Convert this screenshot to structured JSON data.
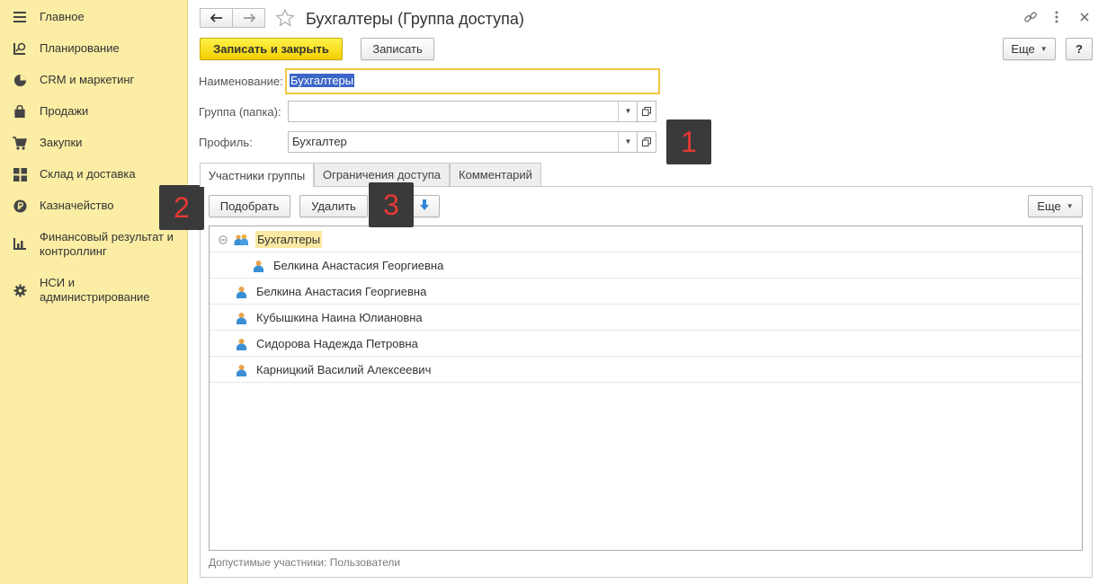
{
  "sidebar": {
    "items": [
      {
        "label": "Главное",
        "icon": "menu-icon"
      },
      {
        "label": "Планирование",
        "icon": "planning-icon"
      },
      {
        "label": "CRM и маркетинг",
        "icon": "pie-chart-icon"
      },
      {
        "label": "Продажи",
        "icon": "shopping-bag-icon"
      },
      {
        "label": "Закупки",
        "icon": "cart-icon"
      },
      {
        "label": "Склад и доставка",
        "icon": "warehouse-grid-icon"
      },
      {
        "label": "Казначейство",
        "icon": "ruble-coin-icon"
      },
      {
        "label": "Финансовый результат и контроллинг",
        "icon": "bar-chart-icon"
      },
      {
        "label": "НСИ и администрирование",
        "icon": "gear-icon"
      }
    ]
  },
  "header": {
    "title": "Бухгалтеры (Группа доступа)",
    "back_icon": "arrow-left-icon",
    "forward_icon": "arrow-right-icon",
    "favorite_icon": "star-icon",
    "link_icon": "link-icon",
    "more_icon": "more-vertical-icon",
    "close_icon": "close-icon"
  },
  "toolbar": {
    "save_close_label": "Записать и закрыть",
    "save_label": "Записать",
    "more_label": "Еще",
    "help_label": "?"
  },
  "form": {
    "name_label": "Наименование:",
    "name_value": "Бухгалтеры",
    "group_label": "Группа (папка):",
    "group_value": "",
    "profile_label": "Профиль:",
    "profile_value": "Бухгалтер"
  },
  "callouts": [
    "1",
    "2",
    "3"
  ],
  "tabs": [
    {
      "label": "Участники группы",
      "active": true
    },
    {
      "label": "Ограничения доступа",
      "active": false
    },
    {
      "label": "Комментарий",
      "active": false
    }
  ],
  "members_toolbar": {
    "pick_label": "Подобрать",
    "delete_label": "Удалить",
    "more_label": "Еще"
  },
  "members": [
    {
      "name": "Бухгалтеры",
      "type": "group",
      "level": 0
    },
    {
      "name": "Белкина Анастасия Георгиевна",
      "type": "user",
      "level": 1
    },
    {
      "name": "Белкина Анастасия Георгиевна",
      "type": "user",
      "level": 0
    },
    {
      "name": "Кубышкина Наина Юлиановна",
      "type": "user",
      "level": 0
    },
    {
      "name": "Сидорова Надежда Петровна",
      "type": "user",
      "level": 0
    },
    {
      "name": "Карницкий Василий Алексеевич",
      "type": "user",
      "level": 0
    }
  ],
  "footer_text": "Допустимые участники: Пользователи",
  "colors": {
    "sidebar_bg": "#fbeda4",
    "primary_button": "#f6d90f",
    "focus_border": "#f2c740",
    "selection": "#3d66c8",
    "callout_bg": "#3a3a3a",
    "callout_text": "#e53935"
  }
}
